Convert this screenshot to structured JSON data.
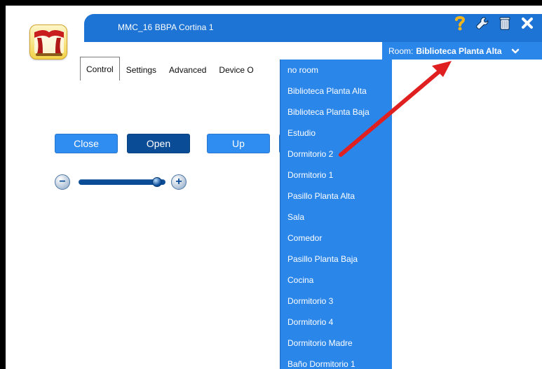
{
  "window": {
    "title": "MMC_16 BBPA Cortina 1"
  },
  "toolbar": {
    "icons": [
      "help-icon",
      "wrench-icon",
      "trash-icon",
      "close-icon"
    ],
    "colors": {
      "help": "#f2b51b",
      "close": "#ffffff"
    }
  },
  "room": {
    "label": "Room:",
    "value": "Biblioteca Planta Alta"
  },
  "tabs": [
    {
      "label": "Control"
    },
    {
      "label": "Settings"
    },
    {
      "label": "Advanced"
    },
    {
      "label": "Device O"
    }
  ],
  "controls": {
    "buttons": {
      "close": "Close",
      "open": "Open",
      "up": "Up"
    },
    "slider": {
      "decrease": "−",
      "increase": "+",
      "level": 0.95
    }
  },
  "dropdown": {
    "items": [
      "no room",
      "Biblioteca Planta Alta",
      "Biblioteca Planta Baja",
      "Estudio",
      "Dormitorio 2",
      "Dormitorio 1",
      "Pasillo Planta Alta",
      "Sala",
      "Comedor",
      "Pasillo Planta Baja",
      "Cocina",
      "Dormitorio 3",
      "Dormitorio 4",
      "Dormitorio Madre",
      "Baño Dormitorio 1"
    ]
  },
  "theme": {
    "blue": "#2b86ea",
    "darkBlue": "#0b4c97",
    "accentRed": "#e02020"
  }
}
